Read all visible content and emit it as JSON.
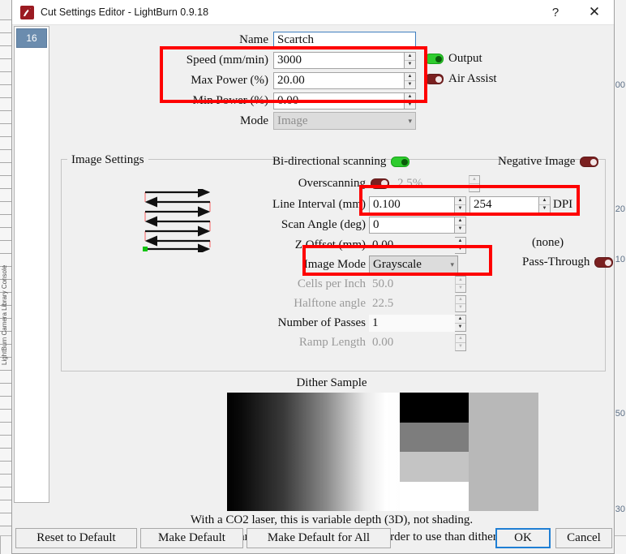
{
  "window": {
    "title": "Cut Settings Editor - LightBurn 0.9.18",
    "help_label": "?",
    "close_label": "✕"
  },
  "cut_list": {
    "items": [
      {
        "label": "16",
        "selected": true
      }
    ]
  },
  "settings": {
    "name_label": "Name",
    "name_value": "Scartch",
    "speed_label": "Speed (mm/min)",
    "speed_value": "3000",
    "max_power_label": "Max Power (%)",
    "max_power_value": "20.00",
    "min_power_label": "Min Power (%)",
    "min_power_value": "0.00",
    "mode_label": "Mode",
    "mode_value": "Image",
    "output_label": "Output",
    "output_state": "on",
    "air_assist_label": "Air Assist",
    "air_assist_state": "off"
  },
  "image_settings": {
    "group_title": "Image Settings",
    "bidirectional_label": "Bi-directional scanning",
    "bidirectional_state": "on",
    "negative_label": "Negative Image",
    "negative_state": "off",
    "overscanning_label": "Overscanning",
    "overscanning_state": "off",
    "overscanning_value": "2.5%",
    "line_interval_label": "Line Interval (mm)",
    "line_interval_value": "0.100",
    "dpi_value": "254",
    "dpi_label": "DPI",
    "scan_angle_label": "Scan Angle (deg)",
    "scan_angle_value": "0",
    "z_offset_label": "Z Offset (mm)",
    "z_offset_value": "0.00",
    "z_offset_none": "(none)",
    "image_mode_label": "Image Mode",
    "image_mode_value": "Grayscale",
    "pass_through_label": "Pass-Through",
    "pass_through_state": "off",
    "cells_per_inch_label": "Cells per Inch",
    "cells_per_inch_value": "50.0",
    "halftone_angle_label": "Halftone angle",
    "halftone_angle_value": "22.5",
    "passes_label": "Number of Passes",
    "passes_value": "1",
    "ramp_length_label": "Ramp Length",
    "ramp_length_value": "0.00"
  },
  "dither": {
    "title": "Dither Sample",
    "help_line_1": "With a CO2 laser, this is variable depth (3D), not shading.",
    "help_line_2": "With a diode this can give great shading, but is harder to use than dithering.",
    "block_colors": [
      "#000000",
      "#7d7d7d",
      "#c4c4c4",
      "#ffffff"
    ],
    "solid_color": "#b8b8b8"
  },
  "footer": {
    "reset_label": "Reset to Default",
    "make_default_label": "Make Default",
    "make_default_all_label": "Make Default for All",
    "ok_label": "OK",
    "cancel_label": "Cancel"
  },
  "background": {
    "vertical_text": "LightBurn  Camera  Library  Console",
    "right_numbers": [
      "00",
      "20",
      "10",
      "50",
      "30"
    ]
  },
  "annotations": {
    "accent_color": "#fe0000",
    "box_1": "speed-power-group",
    "box_2": "line-interval-dpi",
    "box_3": "image-mode"
  }
}
